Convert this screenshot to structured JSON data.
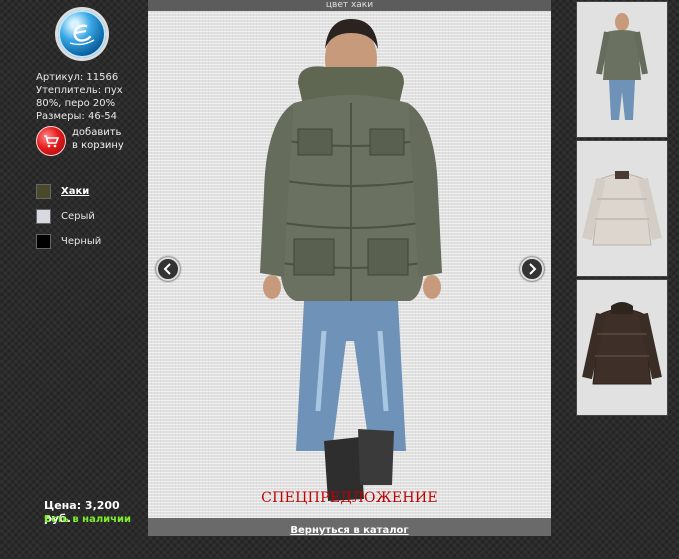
{
  "product": {
    "sku_label": "Артикул: 11566",
    "insulation_line1": "Утеплитель: пух",
    "insulation_line2": "80%, перо 20%",
    "sizes_label": "Размеры: 46-54",
    "add_to_cart_line1": "добавить",
    "add_to_cart_line2": "в корзину",
    "price_label": "Цена: 3,200 руб.",
    "stock_label": "Есть в наличии"
  },
  "colors": [
    {
      "label": "Хаки",
      "swatch": "#4a4a2a",
      "active": true
    },
    {
      "label": "Серый",
      "swatch": "#d8d8e0",
      "active": false
    },
    {
      "label": "Черный",
      "swatch": "#000000",
      "active": false
    }
  ],
  "viewer": {
    "caption": "цвет хаки",
    "special_offer": "СПЕЦПРЕДЛОЖЕНИЕ",
    "back_to_catalog": "Вернуться в каталог"
  },
  "thumbnails": [
    {
      "color": "khaki"
    },
    {
      "color": "light-gray"
    },
    {
      "color": "dark-brown"
    }
  ],
  "theme": {
    "accent_red": "#c10000",
    "stock_green": "#7ef02a"
  }
}
